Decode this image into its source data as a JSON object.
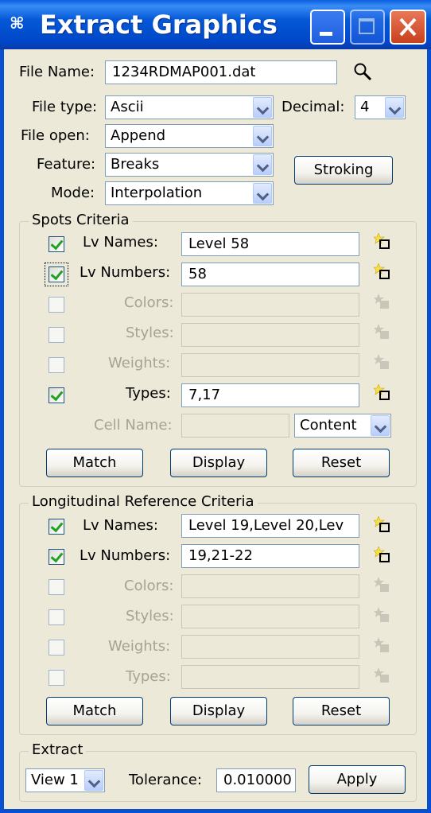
{
  "window": {
    "title": "Extract Graphics"
  },
  "file": {
    "name_label": "File Name:",
    "name_value": "1234RDMAP001.dat",
    "type_label": "File type:",
    "type_value": "Ascii",
    "decimal_label": "Decimal:",
    "decimal_value": "4",
    "open_label": "File open:",
    "open_value": "Append",
    "feature_label": "Feature:",
    "feature_value": "Breaks",
    "mode_label": "Mode:",
    "mode_value": "Interpolation",
    "stroking_label": "Stroking"
  },
  "spots": {
    "title": "Spots Criteria",
    "rows": [
      {
        "label": "Lv Names:",
        "value": "Level 58",
        "checked": true,
        "enabled": true
      },
      {
        "label": "Lv Numbers:",
        "value": "58",
        "checked": true,
        "enabled": true
      },
      {
        "label": "Colors:",
        "value": "",
        "checked": false,
        "enabled": false
      },
      {
        "label": "Styles:",
        "value": "",
        "checked": false,
        "enabled": false
      },
      {
        "label": "Weights:",
        "value": "",
        "checked": false,
        "enabled": false
      },
      {
        "label": "Types:",
        "value": "7,17",
        "checked": true,
        "enabled": true
      }
    ],
    "cell_label": "Cell Name:",
    "cell_value": "",
    "cell_mode": "Content",
    "match": "Match",
    "display": "Display",
    "reset": "Reset"
  },
  "longitudinal": {
    "title": "Longitudinal Reference  Criteria",
    "rows": [
      {
        "label": "Lv Names:",
        "value": "Level 19,Level 20,Lev",
        "checked": true,
        "enabled": true
      },
      {
        "label": "Lv Numbers:",
        "value": "19,21-22",
        "checked": true,
        "enabled": true
      },
      {
        "label": "Colors:",
        "value": "",
        "checked": false,
        "enabled": false
      },
      {
        "label": "Styles:",
        "value": "",
        "checked": false,
        "enabled": false
      },
      {
        "label": "Weights:",
        "value": "",
        "checked": false,
        "enabled": false
      },
      {
        "label": "Types:",
        "value": "",
        "checked": false,
        "enabled": false
      }
    ],
    "match": "Match",
    "display": "Display",
    "reset": "Reset"
  },
  "extract": {
    "title": "Extract",
    "view_value": "View 1",
    "tolerance_label": "Tolerance:",
    "tolerance_value": "0.010000",
    "apply": "Apply"
  }
}
